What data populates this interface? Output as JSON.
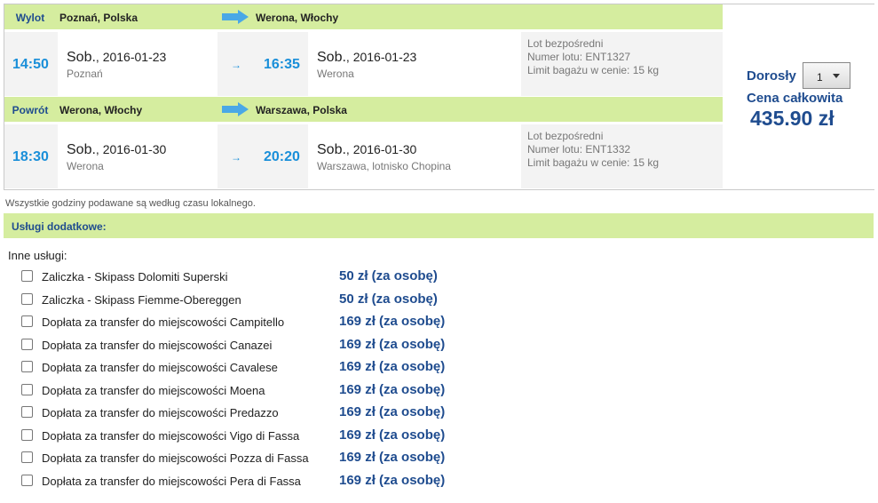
{
  "flights": [
    {
      "direction": "Wylot",
      "from_city": "Poznań, Polska",
      "to_city": "Werona, Włochy",
      "depart_time": "14:50",
      "depart_day": "Sob.",
      "depart_date": ", 2016-01-23",
      "depart_place": "Poznań",
      "arrive_time": "16:35",
      "arrive_day": "Sob.",
      "arrive_date": ", 2016-01-23",
      "arrive_place": "Werona",
      "info_type": "Lot bezpośredni",
      "info_number": "Numer lotu: ENT1327",
      "info_baggage": "Limit bagażu w cenie: 15 kg"
    },
    {
      "direction": "Powrót",
      "from_city": "Werona, Włochy",
      "to_city": "Warszawa, Polska",
      "depart_time": "18:30",
      "depart_day": "Sob.",
      "depart_date": ", 2016-01-30",
      "depart_place": "Werona",
      "arrive_time": "20:20",
      "arrive_day": "Sob.",
      "arrive_date": ", 2016-01-30",
      "arrive_place": "Warszawa, lotnisko Chopina",
      "info_type": "Lot bezpośredni",
      "info_number": "Numer lotu: ENT1332",
      "info_baggage": "Limit bagażu w cenie: 15 kg"
    }
  ],
  "price_panel": {
    "adult_label": "Dorosły",
    "adult_count": "1",
    "total_label": "Cena całkowita",
    "total_price": "435.90 zł"
  },
  "note": "Wszystkie godziny podawane są według czasu lokalnego.",
  "services": {
    "header": "Usługi dodatkowe:",
    "other_label": "Inne usługi:",
    "items": [
      {
        "name": "Zaliczka - Skipass Dolomiti Superski",
        "price": "50 zł (za osobę)"
      },
      {
        "name": "Zaliczka - Skipass Fiemme-Obereggen",
        "price": "50 zł (za osobę)"
      },
      {
        "name": "Dopłata za transfer do miejscowości Campitello",
        "price": "169 zł (za osobę)"
      },
      {
        "name": "Dopłata za transfer do miejscowości Canazei",
        "price": "169 zł (za osobę)"
      },
      {
        "name": "Dopłata za transfer do miejscowości Cavalese",
        "price": "169 zł (za osobę)"
      },
      {
        "name": "Dopłata za transfer do miejscowości Moena",
        "price": "169 zł (za osobę)"
      },
      {
        "name": "Dopłata za transfer do miejscowości Predazzo",
        "price": "169 zł (za osobę)"
      },
      {
        "name": "Dopłata za transfer do miejscowości Vigo di Fassa",
        "price": "169 zł (za osobę)"
      },
      {
        "name": "Dopłata za transfer do miejscowości Pozza di Fassa",
        "price": "169 zł (za osobę)"
      },
      {
        "name": "Dopłata za transfer do miejscowości Pera di Fassa",
        "price": "169 zł (za osobę)"
      }
    ]
  },
  "colors": {
    "accent_green": "#d5ed9f",
    "brand_blue": "#1f4c8f",
    "time_blue": "#1a8fd9"
  }
}
